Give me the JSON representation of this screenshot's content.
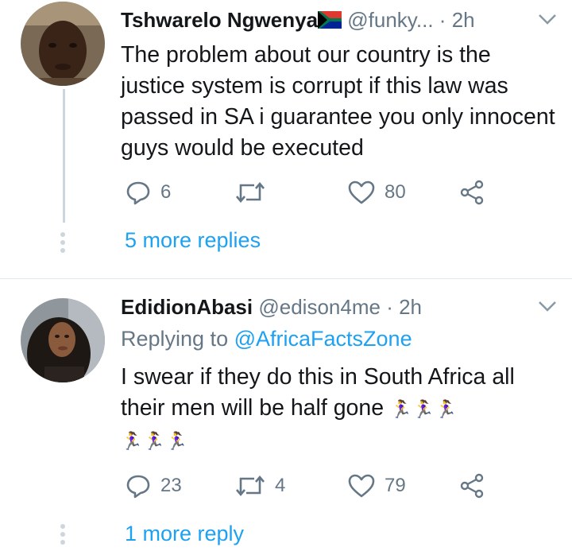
{
  "tweets": [
    {
      "name": "Tshwarelo Ngwenya",
      "flag_emoji": "🇿🇦",
      "handle": "@funky...",
      "dot": "·",
      "time": "2h",
      "replying_prefix": "",
      "replying_to": "",
      "text": "The problem about our country is the justice system is corrupt if this law was passed in SA i guarantee  you only innocent guys would be executed",
      "emoji_line_1": "",
      "emoji_line_2": "",
      "replies": "6",
      "retweets": "",
      "likes": "80",
      "more_replies": "5 more replies"
    },
    {
      "name": "EdidionAbasi",
      "flag_emoji": "",
      "handle": "@edison4me",
      "dot": "·",
      "time": "2h",
      "replying_prefix": "Replying to",
      "replying_to": "@AfricaFactsZone",
      "text": "I swear if they do this in South Africa all their men will be half gone",
      "emoji_line_1": "🏃‍♀🏃‍♀🏃‍♀",
      "emoji_line_2": "🏃‍♀🏃‍♀🏃‍♀",
      "replies": "23",
      "retweets": "4",
      "likes": "79",
      "more_replies": "1 more reply"
    }
  ],
  "colors": {
    "accent": "#1da1f2",
    "secondary_text": "#657786",
    "thread_line": "#ccd6dd",
    "divider": "#e1e8ed"
  },
  "icons": [
    "reply-icon",
    "retweet-icon",
    "like-icon",
    "share-icon",
    "chevron-down-icon"
  ]
}
